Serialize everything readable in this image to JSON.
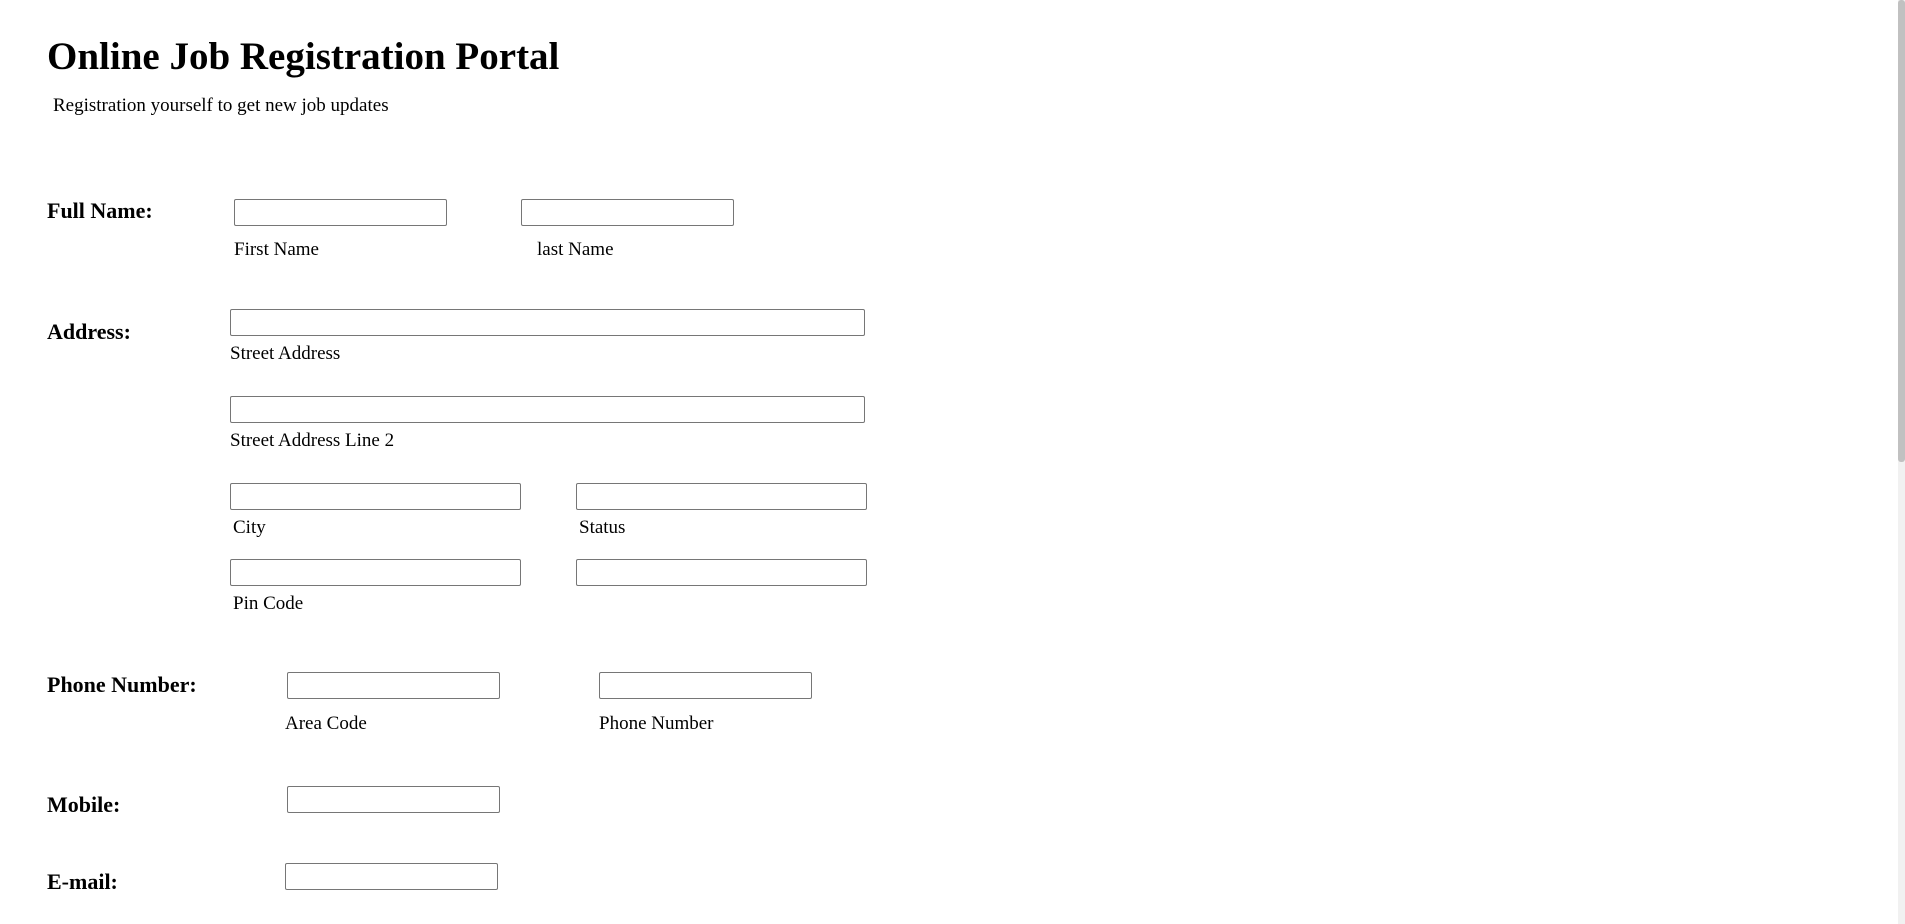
{
  "header": {
    "title": "Online Job Registration Portal",
    "subtitle": "Registration yourself to get new job updates"
  },
  "full_name": {
    "label": "Full Name:",
    "first": {
      "value": "",
      "caption": "First Name"
    },
    "last": {
      "value": "",
      "caption": "last Name"
    }
  },
  "address": {
    "label": "Address:",
    "street": {
      "value": "",
      "caption": "Street Address"
    },
    "street2": {
      "value": "",
      "caption": "Street Address Line 2"
    },
    "city": {
      "value": "",
      "caption": "City"
    },
    "status": {
      "value": "",
      "caption": "Status"
    },
    "pin": {
      "value": "",
      "caption": "Pin Code"
    },
    "extra": {
      "value": ""
    }
  },
  "phone": {
    "label": "Phone Number:",
    "area": {
      "value": "",
      "caption": "Area Code"
    },
    "number": {
      "value": "",
      "caption": "Phone Number"
    }
  },
  "mobile": {
    "label": "Mobile:",
    "value": ""
  },
  "email": {
    "label": "E-mail:",
    "value": ""
  }
}
